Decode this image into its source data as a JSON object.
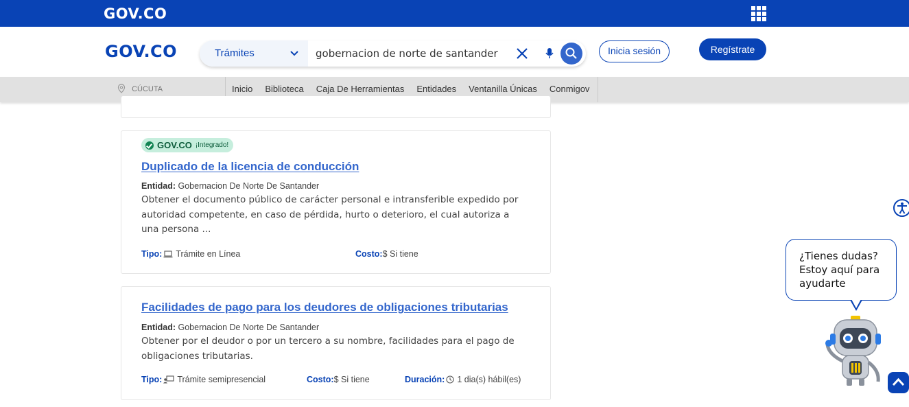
{
  "topbar": {
    "logo": "GOV.CO"
  },
  "header": {
    "logo": "GOV.CO",
    "search": {
      "category": "Trámites",
      "query": "gobernacion de norte de santander"
    },
    "login_label": "Inicia sesión",
    "register_label": "Regístrate"
  },
  "navbar": {
    "location": "CÚCUTA",
    "items": [
      "Inicio",
      "Biblioteca",
      "Caja De Herramientas",
      "Entidades",
      "Ventanilla Únicas",
      "Conmigov"
    ]
  },
  "results": [
    {
      "badge": {
        "brand": "GOV.CO",
        "tag": "¡Integrado!"
      },
      "title": "Duplicado de la licencia de conducción",
      "entidad_label": "Entidad:",
      "entidad": "Gobernacion De Norte De Santander",
      "description": "Obtener el documento público de carácter personal e intransferible expedido por autoridad competente, en caso de pérdida, hurto o deterioro, el cual autoriza a una persona ...",
      "tipo_label": "Tipo:",
      "tipo": "Trámite en Línea",
      "costo_label": "Costo:",
      "costo": "$ Si tiene"
    },
    {
      "title": "Facilidades de pago para los deudores de obligaciones tributarias",
      "entidad_label": "Entidad:",
      "entidad": "Gobernacion De Norte De Santander",
      "description": "Obtener por el deudor o por un tercero a su nombre, facilidades para el pago de obligaciones tributarias.",
      "tipo_label": "Tipo:",
      "tipo": "Trámite semipresencial",
      "costo_label": "Costo:",
      "costo": "$ Si tiene",
      "duracion_label": "Duración:",
      "duracion": "1 dia(s) hábil(es)"
    }
  ],
  "chat": {
    "line1": "¿Tienes dudas?",
    "line2": "Estoy aquí para",
    "line3": "ayudarte"
  },
  "colors": {
    "primary": "#0943b5",
    "link": "#3366cc",
    "badge_bg": "#c6eedd",
    "badge_text": "#0b5b3a"
  }
}
